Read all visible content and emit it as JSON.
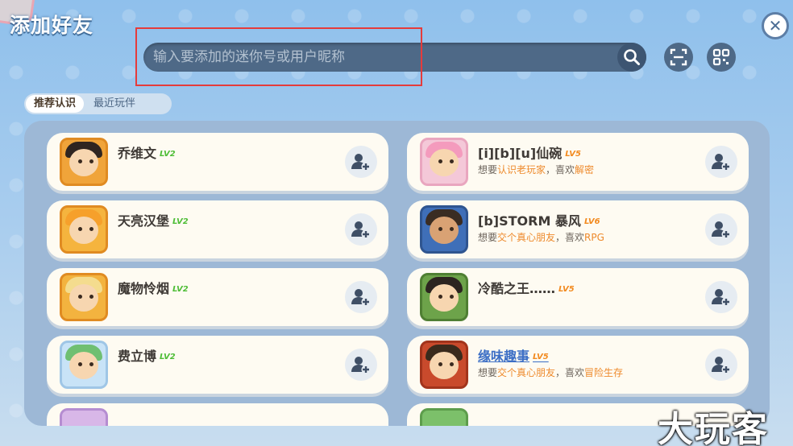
{
  "header": {
    "title": "添加好友",
    "close_icon": "close-icon",
    "close_glyph": "✕"
  },
  "search": {
    "placeholder": "输入要添加的迷你号或用户昵称",
    "value": ""
  },
  "tabs": [
    {
      "label": "推荐认识",
      "active": true
    },
    {
      "label": "最近玩伴",
      "active": false
    }
  ],
  "friends_left": [
    {
      "name": "乔维文",
      "level": "LV2",
      "level_color": "green",
      "avatar_bg": "#f0a43a",
      "hair": "#2f2520",
      "desc": null
    },
    {
      "name": "天亮汉堡",
      "level": "LV2",
      "level_color": "green",
      "avatar_bg": "#f5b43e",
      "hair": "#f6a02b",
      "desc": null
    },
    {
      "name": "魔物怜烟",
      "level": "LV2",
      "level_color": "green",
      "avatar_bg": "#f3b33f",
      "hair": "#f4dc8e",
      "desc": null
    },
    {
      "name": "费立博",
      "level": "LV2",
      "level_color": "green",
      "avatar_bg": "#c8e3f7",
      "hair": "#6fbf71",
      "desc": null
    }
  ],
  "friends_right": [
    {
      "name": "[i][b][u]仙碗",
      "level": "LV5",
      "level_color": "orange",
      "avatar_bg": "#f4c8d8",
      "hair": "#f49bbd",
      "desc_prefix": "想要",
      "desc_hl1": "认识老玩家",
      "desc_mid": "，喜欢",
      "desc_hl2": "解密"
    },
    {
      "name": "[b]STORM 暴风",
      "level": "LV6",
      "level_color": "orange",
      "avatar_bg": "#3f6fb8",
      "hair": "#3a2c22",
      "desc_prefix": "想要",
      "desc_hl1": "交个真心朋友",
      "desc_mid": "，喜欢",
      "desc_hl2": "RPG"
    },
    {
      "name": "冷酷之王……",
      "level": "LV5",
      "level_color": "orange",
      "avatar_bg": "#6da34a",
      "hair": "#2c2420",
      "desc_prefix": null
    },
    {
      "name": "缘味趣事",
      "level": "LV5",
      "level_color": "orange",
      "avatar_bg": "#c94a2c",
      "hair": "#3a2a1c",
      "name_style": "blue",
      "desc_prefix": "想要",
      "desc_hl1": "交个真心朋友",
      "desc_mid": "，喜欢",
      "desc_hl2": "冒险生存"
    }
  ],
  "add_friend_icon": "add-user-icon",
  "search_icon": "search-icon",
  "scan_icon": "scan-icon",
  "qrcode_icon": "qrcode-icon",
  "watermark": "大玩客",
  "colors": {
    "highlight_box": "#e53b3b",
    "level_green": "#4fbd37",
    "level_orange": "#f28a1f",
    "desc_highlight": "#ee8a2c"
  }
}
